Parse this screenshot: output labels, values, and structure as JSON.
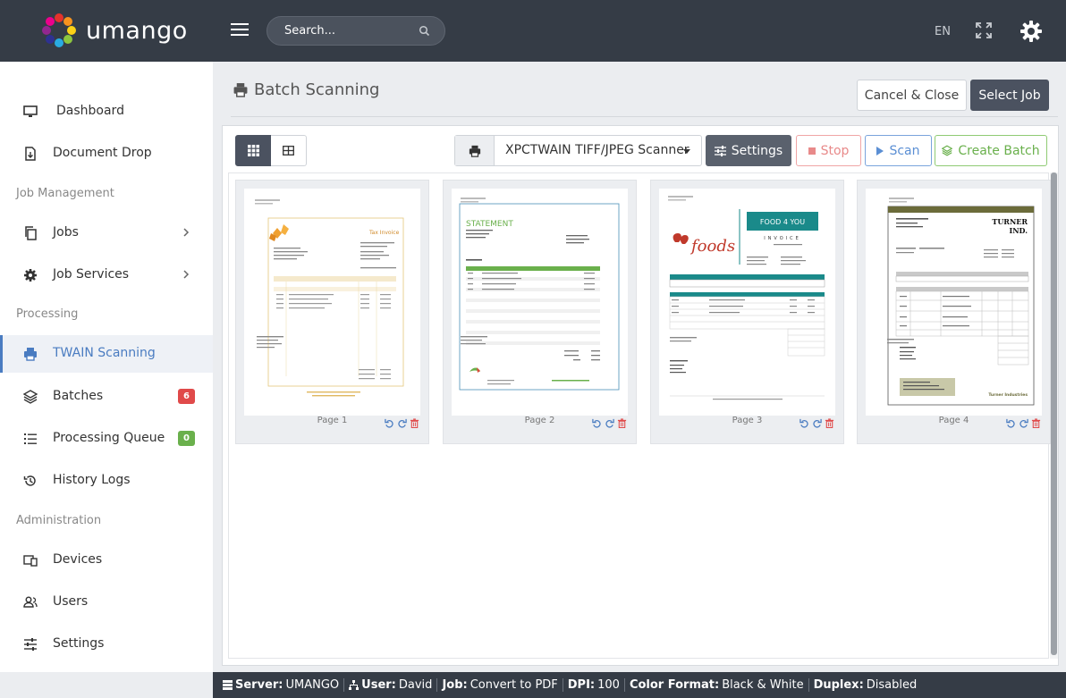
{
  "header": {
    "logo_text": "umango",
    "search_placeholder": "Search...",
    "language": "EN"
  },
  "sidebar": {
    "items": [
      {
        "label": "Dashboard",
        "icon": "monitor-icon"
      },
      {
        "label": "Document Drop",
        "icon": "file-drop-icon"
      },
      {
        "label": "Jobs",
        "icon": "copy-icon"
      },
      {
        "label": "Job Services",
        "icon": "gear-icon"
      },
      {
        "label": "TWAIN Scanning",
        "icon": "printer-icon"
      },
      {
        "label": "Batches",
        "icon": "layers-icon",
        "badge": "6"
      },
      {
        "label": "Processing Queue",
        "icon": "list-icon",
        "badge": "0"
      },
      {
        "label": "History Logs",
        "icon": "history-icon"
      },
      {
        "label": "Devices",
        "icon": "devices-icon"
      },
      {
        "label": "Users",
        "icon": "users-icon"
      },
      {
        "label": "Settings",
        "icon": "sliders-icon"
      }
    ],
    "sections": [
      "Job Management",
      "Processing",
      "Administration"
    ],
    "badge_colors": {
      "batches": "#e04a4a",
      "queue": "#6ab04c"
    }
  },
  "main": {
    "title": "Batch Scanning",
    "cancel_label": "Cancel & Close",
    "select_job_label": "Select Job",
    "scanner_name": "XPCTWAIN TIFF/JPEG Scanner",
    "settings_label": "Settings",
    "stop_label": "Stop",
    "scan_label": "Scan",
    "create_batch_label": "Create Batch",
    "pages": [
      {
        "label": "Page 1"
      },
      {
        "label": "Page 2"
      },
      {
        "label": "Page 3"
      },
      {
        "label": "Page 4"
      }
    ],
    "thumb_text": {
      "p1_title": "Tax Invoice",
      "p2_title": "STATEMENT",
      "p3_brand": "foods",
      "p3_banner": "FOOD 4 YOU",
      "p3_sub": "INVOICE",
      "p4_company": "TURNER",
      "p4_company2": "IND.",
      "p4_footer": "Turner Industries"
    }
  },
  "footer": {
    "server_label": "Server:",
    "server_value": "UMANGO",
    "user_label": "User:",
    "user_value": "David",
    "job_label": "Job:",
    "job_value": "Convert to PDF",
    "dpi_label": "DPI:",
    "dpi_value": "100",
    "color_label": "Color Format:",
    "color_value": "Black & White",
    "duplex_label": "Duplex:",
    "duplex_value": "Disabled"
  }
}
